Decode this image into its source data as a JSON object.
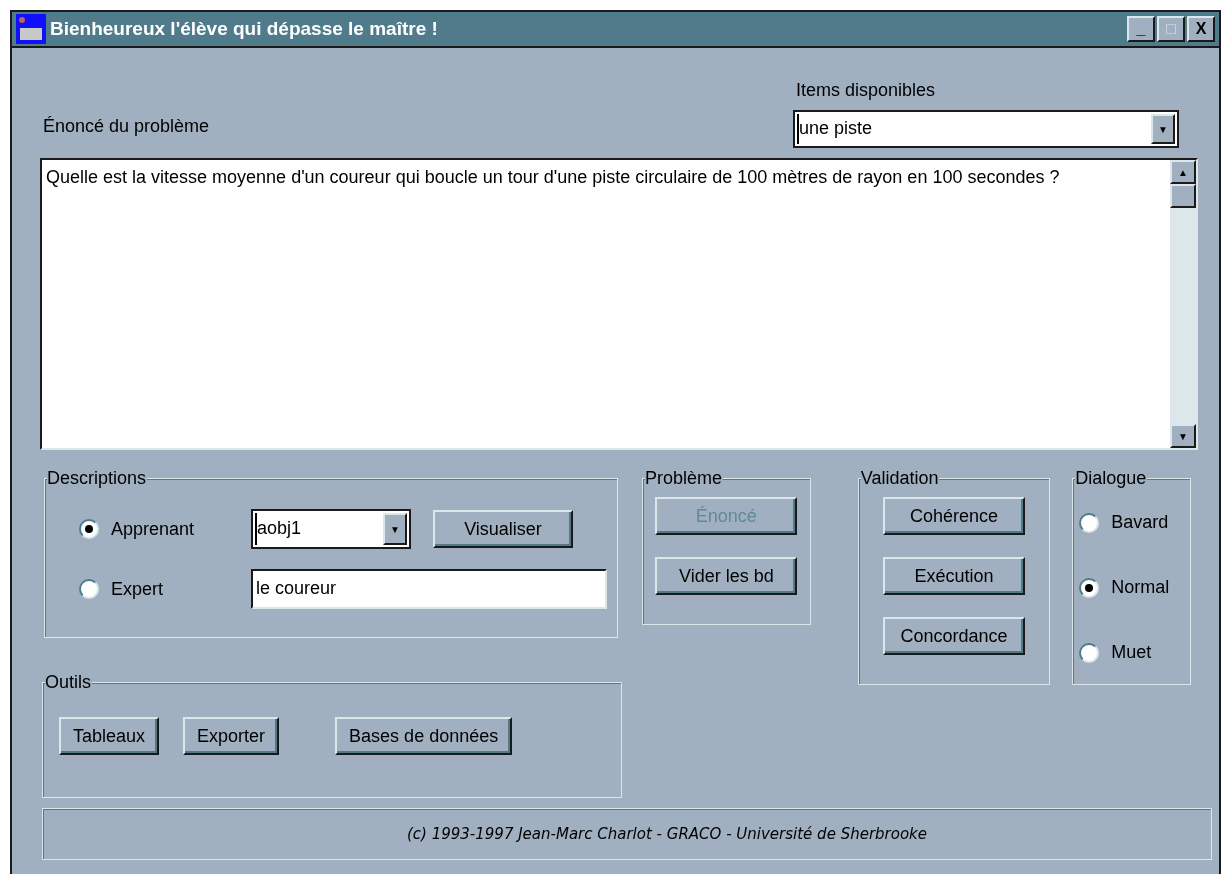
{
  "window": {
    "title": "Bienheureux l'élève qui dépasse le maître !",
    "controls": [
      "_",
      "□",
      "X"
    ]
  },
  "items": {
    "label": "Items disponibles",
    "value": "une piste",
    "arrow": "▼"
  },
  "statement": {
    "label": "Énoncé du problème",
    "text": "Quelle est la vitesse moyenne d'un coureur qui boucle un tour d'une piste circulaire de 100 mètres de rayon en 100 secondes ?",
    "scroll_up": "▲",
    "scroll_down": "▼"
  },
  "descriptions": {
    "title": "Descriptions",
    "options": [
      {
        "label": "Apprenant",
        "selected": true
      },
      {
        "label": "Expert",
        "selected": false
      }
    ],
    "combo": {
      "value": "aobj1",
      "arrow": "▼"
    },
    "button": "Visualiser",
    "field": {
      "value": "le coureur"
    }
  },
  "probleme": {
    "title": "Problème",
    "buttons": [
      {
        "label": "Énoncé",
        "disabled": true
      },
      {
        "label": "Vider les bd",
        "disabled": false
      }
    ]
  },
  "validation": {
    "title": "Validation",
    "buttons": [
      "Cohérence",
      "Exécution",
      "Concordance"
    ]
  },
  "dialogue": {
    "title": "Dialogue",
    "options": [
      {
        "label": "Bavard",
        "selected": false
      },
      {
        "label": "Normal",
        "selected": true
      },
      {
        "label": "Muet",
        "selected": false
      }
    ]
  },
  "outils": {
    "title": "Outils",
    "buttons": [
      "Tableaux",
      "Exporter",
      "Bases de données"
    ]
  },
  "footer": "(c) 1993-1997 Jean-Marc Charlot - GRACO - Université de Sherbrooke"
}
